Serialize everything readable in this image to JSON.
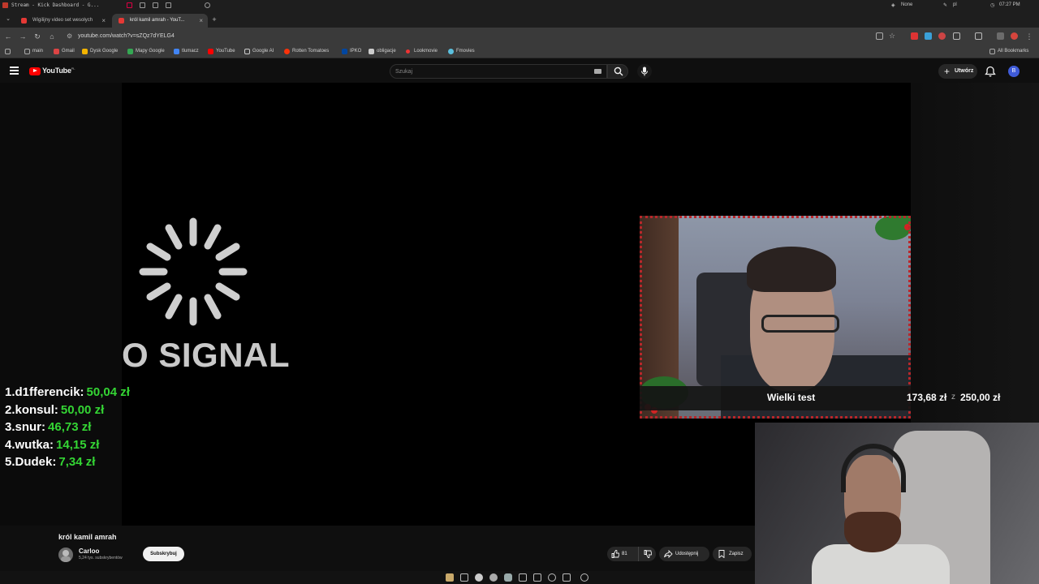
{
  "os_bar": {
    "window_title": "Stream - Kick Dashboard - G...",
    "tray_none": "None",
    "tray_lang": "pl",
    "clock": "07:27 PM"
  },
  "tabs": [
    {
      "title": "Wigilijny video set wesołych"
    },
    {
      "title": "król kamil amrah - YouT..."
    }
  ],
  "address_bar": {
    "url": "youtube.com/watch?v=sZQz7dYELG4"
  },
  "bookmarks": {
    "items": [
      "main",
      "Gmail",
      "Dysk Google",
      "Mapy Google",
      "tlumacz",
      "YouTube",
      "Google AI",
      "Rotten Tomatoes",
      "IPKO",
      "obligacje",
      "Lookmovie",
      "Fmovies"
    ],
    "all_label": "All Bookmarks"
  },
  "youtube": {
    "logo_text": "YouTube",
    "logo_region": "PL",
    "search_placeholder": "Szukaj",
    "create_label": "Utwórz",
    "avatar_letter": "B"
  },
  "player": {
    "no_signal_text": "O SIGNAL",
    "leaderboard": [
      {
        "rank": "1.",
        "name": "d1fferencik:",
        "amount": "50,04 zł"
      },
      {
        "rank": "2.",
        "name": "konsul:",
        "amount": "50,00 zł"
      },
      {
        "rank": "3.",
        "name": "snur:",
        "amount": "46,73 zł"
      },
      {
        "rank": "4.",
        "name": "wutka:",
        "amount": "14,15 zł"
      },
      {
        "rank": "5.",
        "name": "Dudek:",
        "amount": "7,34 zł"
      }
    ],
    "goal": {
      "label": "Wielki test",
      "current": "173,68 zł",
      "separator": "z",
      "target": "250,00 zł"
    }
  },
  "video": {
    "title": "król kamil amrah",
    "channel_name": "Carloo",
    "subscribers": "5,24 tys. subskrybentów",
    "subscribe_label": "Subskrybuj",
    "likes": "81",
    "share_label": "Udostępnij",
    "save_label": "Zapisz"
  },
  "colors": {
    "accent_red": "#ff0000",
    "donation_green": "#34d534",
    "background": "#0f0f0f"
  }
}
